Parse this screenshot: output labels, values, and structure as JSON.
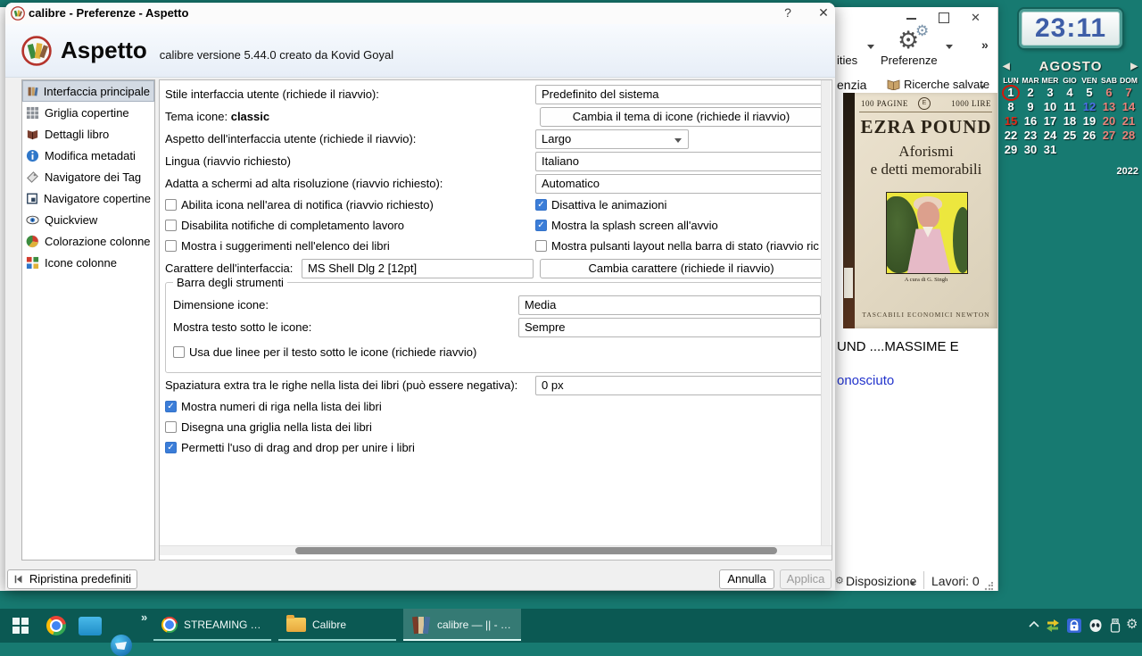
{
  "colors": {
    "desktop": "#177a71",
    "taskbar": "#0b5953",
    "checkbox_accent": "#3b7dd8",
    "sidebar_selection": "#d3dae3",
    "link_blue": "#2233cc"
  },
  "desktop": {
    "clock": {
      "time": "23:11"
    },
    "calendar": {
      "month": "AGOSTO",
      "year": "2022",
      "prev": "◀",
      "next": "▶",
      "weekdays": [
        "LUN",
        "MAR",
        "MER",
        "GIO",
        "VEN",
        "SAB",
        "DOM"
      ],
      "days": [
        {
          "n": "1",
          "c": "ring"
        },
        {
          "n": "2",
          "c": ""
        },
        {
          "n": "3",
          "c": ""
        },
        {
          "n": "4",
          "c": ""
        },
        {
          "n": "5",
          "c": ""
        },
        {
          "n": "6",
          "c": "wk"
        },
        {
          "n": "7",
          "c": "wk"
        },
        {
          "n": "8",
          "c": ""
        },
        {
          "n": "9",
          "c": ""
        },
        {
          "n": "10",
          "c": ""
        },
        {
          "n": "11",
          "c": ""
        },
        {
          "n": "12",
          "c": "blue"
        },
        {
          "n": "13",
          "c": "wk"
        },
        {
          "n": "14",
          "c": "wk"
        },
        {
          "n": "15",
          "c": "hol"
        },
        {
          "n": "16",
          "c": ""
        },
        {
          "n": "17",
          "c": ""
        },
        {
          "n": "18",
          "c": ""
        },
        {
          "n": "19",
          "c": ""
        },
        {
          "n": "20",
          "c": "wk"
        },
        {
          "n": "21",
          "c": "wk"
        },
        {
          "n": "22",
          "c": ""
        },
        {
          "n": "23",
          "c": ""
        },
        {
          "n": "24",
          "c": ""
        },
        {
          "n": "25",
          "c": ""
        },
        {
          "n": "26",
          "c": ""
        },
        {
          "n": "27",
          "c": "wk"
        },
        {
          "n": "28",
          "c": "wk"
        },
        {
          "n": "29",
          "c": ""
        },
        {
          "n": "30",
          "c": ""
        },
        {
          "n": "31",
          "c": ""
        }
      ]
    }
  },
  "dialog": {
    "title": "calibre - Preferenze - Aspetto",
    "controls": {
      "help": "?",
      "close": "✕"
    },
    "header": {
      "title": "Aspetto",
      "subtitle": "calibre versione 5.44.0 creato da Kovid Goyal"
    },
    "sidebar": [
      "Interfaccia principale",
      "Griglia copertine",
      "Dettagli libro",
      "Modifica metadati",
      "Navigatore dei Tag",
      "Navigatore copertine",
      "Quickview",
      "Colorazione colonne",
      "Icone colonne"
    ],
    "form": {
      "ui_style_label": "Stile interfaccia utente (richiede il riavvio):",
      "ui_style_value": "Predefinito del sistema",
      "icon_theme_label": "Tema icone:",
      "icon_theme_name": "classic",
      "icon_theme_button": "Cambia il tema di icone (richiede il riavvio)",
      "layout_label": "Aspetto dell'interfaccia utente (richiede il riavvio):",
      "layout_value": "Largo",
      "language_label": "Lingua (riavvio richiesto)",
      "language_value": "Italiano",
      "hidpi_label": "Adatta a schermi ad alta risoluzione (riavvio richiesto):",
      "hidpi_value": "Automatico",
      "cb_tray": {
        "label": "Abilita icona nell'area di notifica (riavvio richiesto)",
        "checked": false
      },
      "cb_anim": {
        "label": "Disattiva le animazioni",
        "checked": true
      },
      "cb_jobnotif": {
        "label": "Disabilita notifiche di completamento lavoro",
        "checked": false
      },
      "cb_splash": {
        "label": "Mostra la splash screen all'avvio",
        "checked": true
      },
      "cb_tooltips": {
        "label": "Mostra i suggerimenti nell'elenco dei libri",
        "checked": false
      },
      "cb_layoutbtns": {
        "label": "Mostra pulsanti layout nella barra di stato (riavvio ric",
        "checked": false
      },
      "font_label": "Carattere dell'interfaccia:",
      "font_value": "MS Shell Dlg 2 [12pt]",
      "font_button": "Cambia carattere (richiede il riavvio)",
      "toolbar_group": {
        "title": "Barra degli strumenti",
        "icon_size_label": "Dimensione icone:",
        "icon_size_value": "Media",
        "text_label": "Mostra testo sotto le icone:",
        "text_value": "Sempre",
        "cb_two_lines": {
          "label": "Usa due linee per il testo sotto le icone (richiede riavvio)",
          "checked": false
        }
      },
      "spacing_label": "Spaziatura extra tra le righe nella lista dei libri (può essere negativa):",
      "spacing_value": "0 px",
      "cb_rownum": {
        "label": "Mostra numeri di riga nella lista dei libri",
        "checked": true
      },
      "cb_grid": {
        "label": "Disegna una griglia nella lista dei libri",
        "checked": false
      },
      "cb_dragdrop": {
        "label": "Permetti l'uso di drag and drop per unire i libri",
        "checked": true
      }
    },
    "footer": {
      "restore": "Ripristina predefiniti",
      "cancel": "Annulla",
      "apply": "Applica"
    }
  },
  "main_window": {
    "controls": {
      "min": "—",
      "close": "✕"
    },
    "toolbar": {
      "cut_label": "ities",
      "preferences": "Preferenze",
      "overflow": "»"
    },
    "search_row": {
      "cut_label": "enzia",
      "saved": "Ricerche salvate"
    },
    "cover": {
      "pages": "100 PAGINE",
      "price": "1000 LIRE",
      "author": "EZRA POUND",
      "title1": "Aforismi",
      "title2": "e detti memorabili",
      "caption": "A cura di G. Singh",
      "publisher": "TASCABILI ECONOMICI NEWTON"
    },
    "details_line1": "UND ....MASSIME E",
    "details_line2": "onosciuto",
    "status": {
      "layout": "Disposizione",
      "jobs": "Lavori: 0"
    }
  },
  "taskbar": {
    "overflow": "»",
    "launcher_icons": [
      "start-icon",
      "chrome-icon",
      "blue-window-icon",
      "thunderbird-icon"
    ],
    "buttons": [
      {
        "label": "STREAMING TELEL...",
        "icon": "chrome-icon",
        "active": false
      },
      {
        "label": "Calibre",
        "icon": "folder-icon",
        "active": false
      },
      {
        "label": "calibre — || -  Prova...",
        "icon": "calibre-icon",
        "active": true
      }
    ],
    "tray_icons": [
      "expand-chevron-icon",
      "sync-arrows-icon",
      "lock-icon",
      "mask-icon",
      "usb-icon",
      "gear-icon"
    ]
  }
}
